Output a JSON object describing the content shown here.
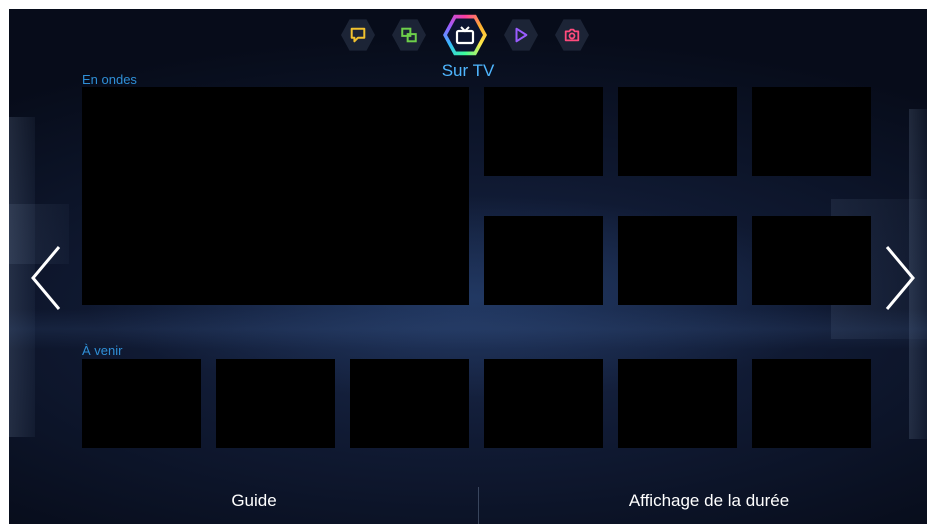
{
  "top_bar": {
    "icons": [
      {
        "name": "chat-icon",
        "color": "#f2c22e"
      },
      {
        "name": "multi-screen-icon",
        "color": "#6ed04a"
      },
      {
        "name": "tv-icon",
        "color": "#ffffff",
        "active": true
      },
      {
        "name": "play-icon",
        "color": "#9a5cff"
      },
      {
        "name": "camera-icon",
        "color": "#ff4b7d"
      }
    ],
    "active_label": "Sur TV"
  },
  "sections": {
    "on_air_label": "En ondes",
    "upcoming_label": "À venir"
  },
  "navigation": {
    "left_arrow": "chevron-left-icon",
    "right_arrow": "chevron-right-icon"
  },
  "bottom_bar": {
    "left_label": "Guide",
    "right_label": "Affichage de la durée"
  },
  "colors": {
    "accent": "#4fb6ff",
    "tile": "#000000",
    "background": "#0c1630"
  }
}
